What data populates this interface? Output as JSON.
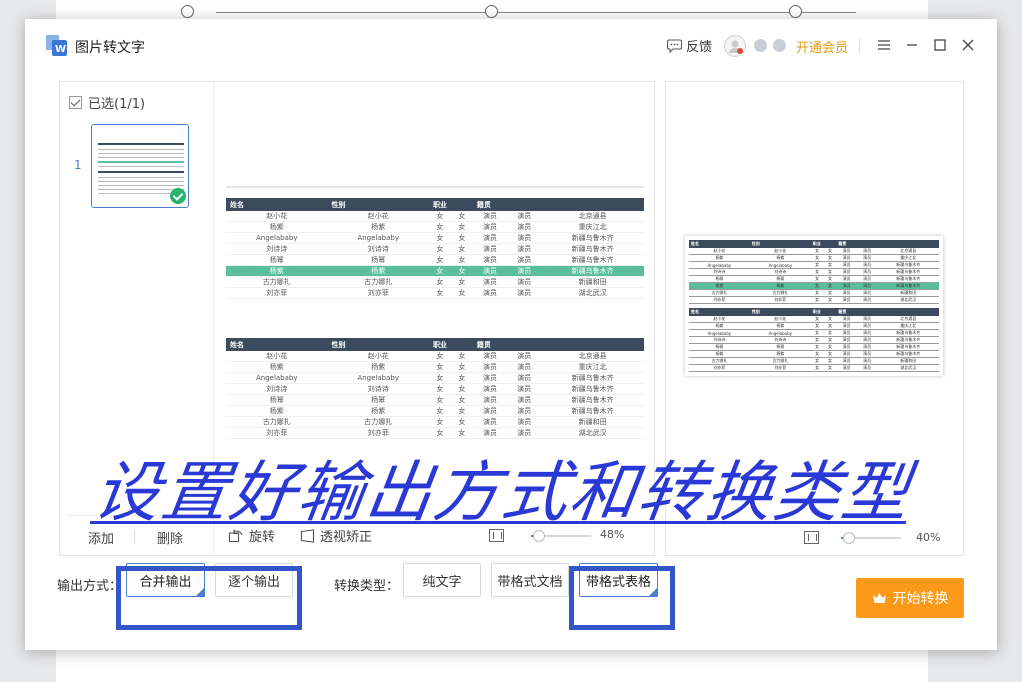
{
  "window": {
    "title": "图片转文字",
    "feedback_label": "反馈",
    "vip_label": "开通会员"
  },
  "thumbnails": {
    "select_all_label": "已选(1/1)",
    "pages": [
      {
        "number": "1",
        "selected": true
      }
    ],
    "add_label": "添加",
    "delete_label": "删除"
  },
  "preview": {
    "rotate_label": "旋转",
    "perspective_label": "透视矫正",
    "zoom": "48%",
    "zoom_fraction": 0.48,
    "table_headers": [
      "姓名",
      "性别",
      "职业",
      "籍贯"
    ],
    "rows_a": [
      [
        "赵小花",
        "赵小花",
        "女",
        "女",
        "演员",
        "演员",
        "北京通县"
      ],
      [
        "杨紫",
        "杨紫",
        "女",
        "女",
        "演员",
        "演员",
        "重庆江北"
      ],
      [
        "Angelababy",
        "Angelababy",
        "女",
        "女",
        "演员",
        "演员",
        "新疆乌鲁木齐"
      ],
      [
        "刘诗诗",
        "刘诗诗",
        "女",
        "女",
        "演员",
        "演员",
        "新疆乌鲁木齐"
      ],
      [
        "杨幂",
        "杨幂",
        "女",
        "女",
        "演员",
        "演员",
        "新疆乌鲁木齐"
      ],
      [
        "杨紫",
        "杨紫",
        "女",
        "女",
        "演员",
        "演员",
        "新疆乌鲁木齐"
      ],
      [
        "古力娜扎",
        "古力娜扎",
        "女",
        "女",
        "演员",
        "演员",
        "新疆和田"
      ],
      [
        "刘亦菲",
        "刘亦菲",
        "女",
        "女",
        "演员",
        "演员",
        "湖北武汉"
      ]
    ],
    "highlight_row_a": 5,
    "rows_b": [
      [
        "赵小花",
        "赵小花",
        "女",
        "女",
        "演员",
        "演员",
        "北京通县"
      ],
      [
        "杨紫",
        "杨紫",
        "女",
        "女",
        "演员",
        "演员",
        "重庆江北"
      ],
      [
        "Angelababy",
        "Angelababy",
        "女",
        "女",
        "演员",
        "演员",
        "新疆乌鲁木齐"
      ],
      [
        "刘诗诗",
        "刘诗诗",
        "女",
        "女",
        "演员",
        "演员",
        "新疆乌鲁木齐"
      ],
      [
        "杨幂",
        "杨幂",
        "女",
        "女",
        "演员",
        "演员",
        "新疆乌鲁木齐"
      ],
      [
        "杨紫",
        "杨紫",
        "女",
        "女",
        "演员",
        "演员",
        "新疆乌鲁木齐"
      ],
      [
        "古力娜扎",
        "古力娜扎",
        "女",
        "女",
        "演员",
        "演员",
        "新疆和田"
      ],
      [
        "刘亦菲",
        "刘亦菲",
        "女",
        "女",
        "演员",
        "演员",
        "湖北武汉"
      ]
    ]
  },
  "result": {
    "zoom": "40%",
    "zoom_fraction": 0.4
  },
  "output_mode": {
    "label": "输出方式：",
    "options": [
      "合并输出",
      "逐个输出"
    ],
    "selected": 0
  },
  "convert_type": {
    "label": "转换类型：",
    "options": [
      "纯文字",
      "带格式文档",
      "带格式表格"
    ],
    "selected": 2
  },
  "start_label": "开始转换",
  "caption": "设置好输出方式和转换类型",
  "colors": {
    "accent": "#4a7fd0",
    "start": "#fb9a19",
    "vip": "#e79a14",
    "highlight_box": "#3356c8",
    "caption": "#2a39d6",
    "table_header": "#3b4a5c",
    "table_highlight": "#5bbf9c"
  }
}
